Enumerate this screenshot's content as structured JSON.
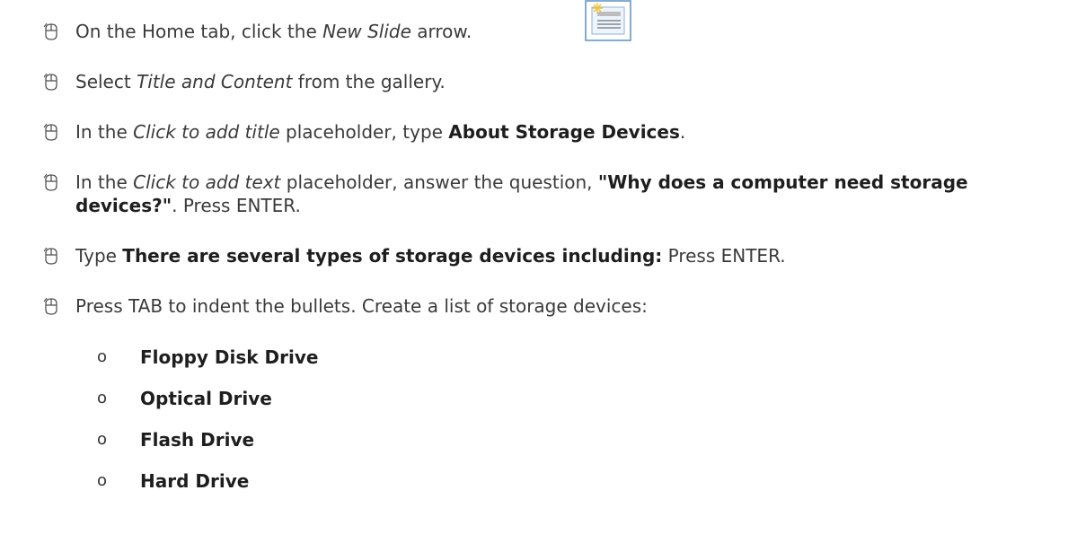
{
  "steps": [
    {
      "before": "On the Home tab, click the ",
      "em": "New Slide",
      "after": " arrow.",
      "icon": "new-slide-icon"
    },
    {
      "before": "Select ",
      "em": "Title and Content",
      "after": " from the gallery."
    },
    {
      "before": "In the ",
      "em": "Click to add title",
      "mid": " placeholder, type ",
      "bold": "About Storage Devices",
      "after": "."
    },
    {
      "before": "In the ",
      "em": "Click to add text",
      "mid": " placeholder, answer the question, ",
      "bold": "\"Why does a computer need storage devices?\"",
      "after": ". Press ENTER."
    },
    {
      "before": "Type ",
      "bold": "There are several types of storage devices including:",
      "after": " Press ENTER."
    },
    {
      "text": "Press TAB to indent the bullets. Create a list of storage devices:"
    }
  ],
  "bullet_glyph": "o",
  "devices": [
    "Floppy Disk Drive",
    "Optical Drive",
    "Flash Drive",
    "Hard Drive"
  ],
  "colors": {
    "text": "#3a3a3a",
    "emphasis": "#1e1e1e",
    "icon_border": "#5b8fc9",
    "icon_sun": "#f4c430"
  }
}
